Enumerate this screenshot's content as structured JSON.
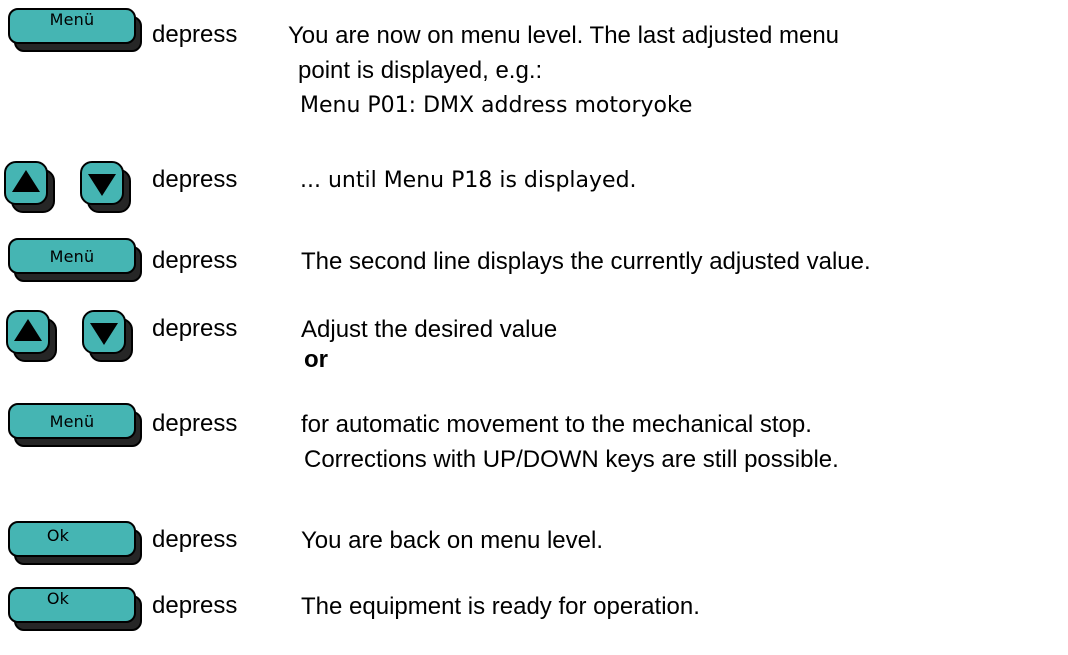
{
  "keys": {
    "menu_label": "Menü",
    "ok_label": "Ok",
    "up_icon": "up-triangle",
    "down_icon": "down-triangle",
    "key_color": "#45b5b3",
    "shadow_color": "#262626"
  },
  "verb": "depress",
  "steps": [
    {
      "key": "Menü",
      "lines": [
        "You are now on menu level. The last adjusted menu",
        "point is displayed, e.g.:",
        "Menu P01: DMX address motoryoke"
      ]
    },
    {
      "key": "up-down",
      "lines": [
        "... until Menu P18 is displayed."
      ]
    },
    {
      "key": "Menü",
      "lines": [
        "The second line displays the currently adjusted value."
      ]
    },
    {
      "key": "up-down",
      "lines": [
        "Adjust the desired value",
        "or"
      ]
    },
    {
      "key": "Menü",
      "lines": [
        "for automatic movement to the mechanical stop.",
        "Corrections with UP/DOWN keys are still possible."
      ]
    },
    {
      "key": "Ok",
      "lines": [
        "You are back on menu level."
      ]
    },
    {
      "key": "Ok",
      "lines": [
        "The equipment is ready for operation."
      ]
    }
  ]
}
